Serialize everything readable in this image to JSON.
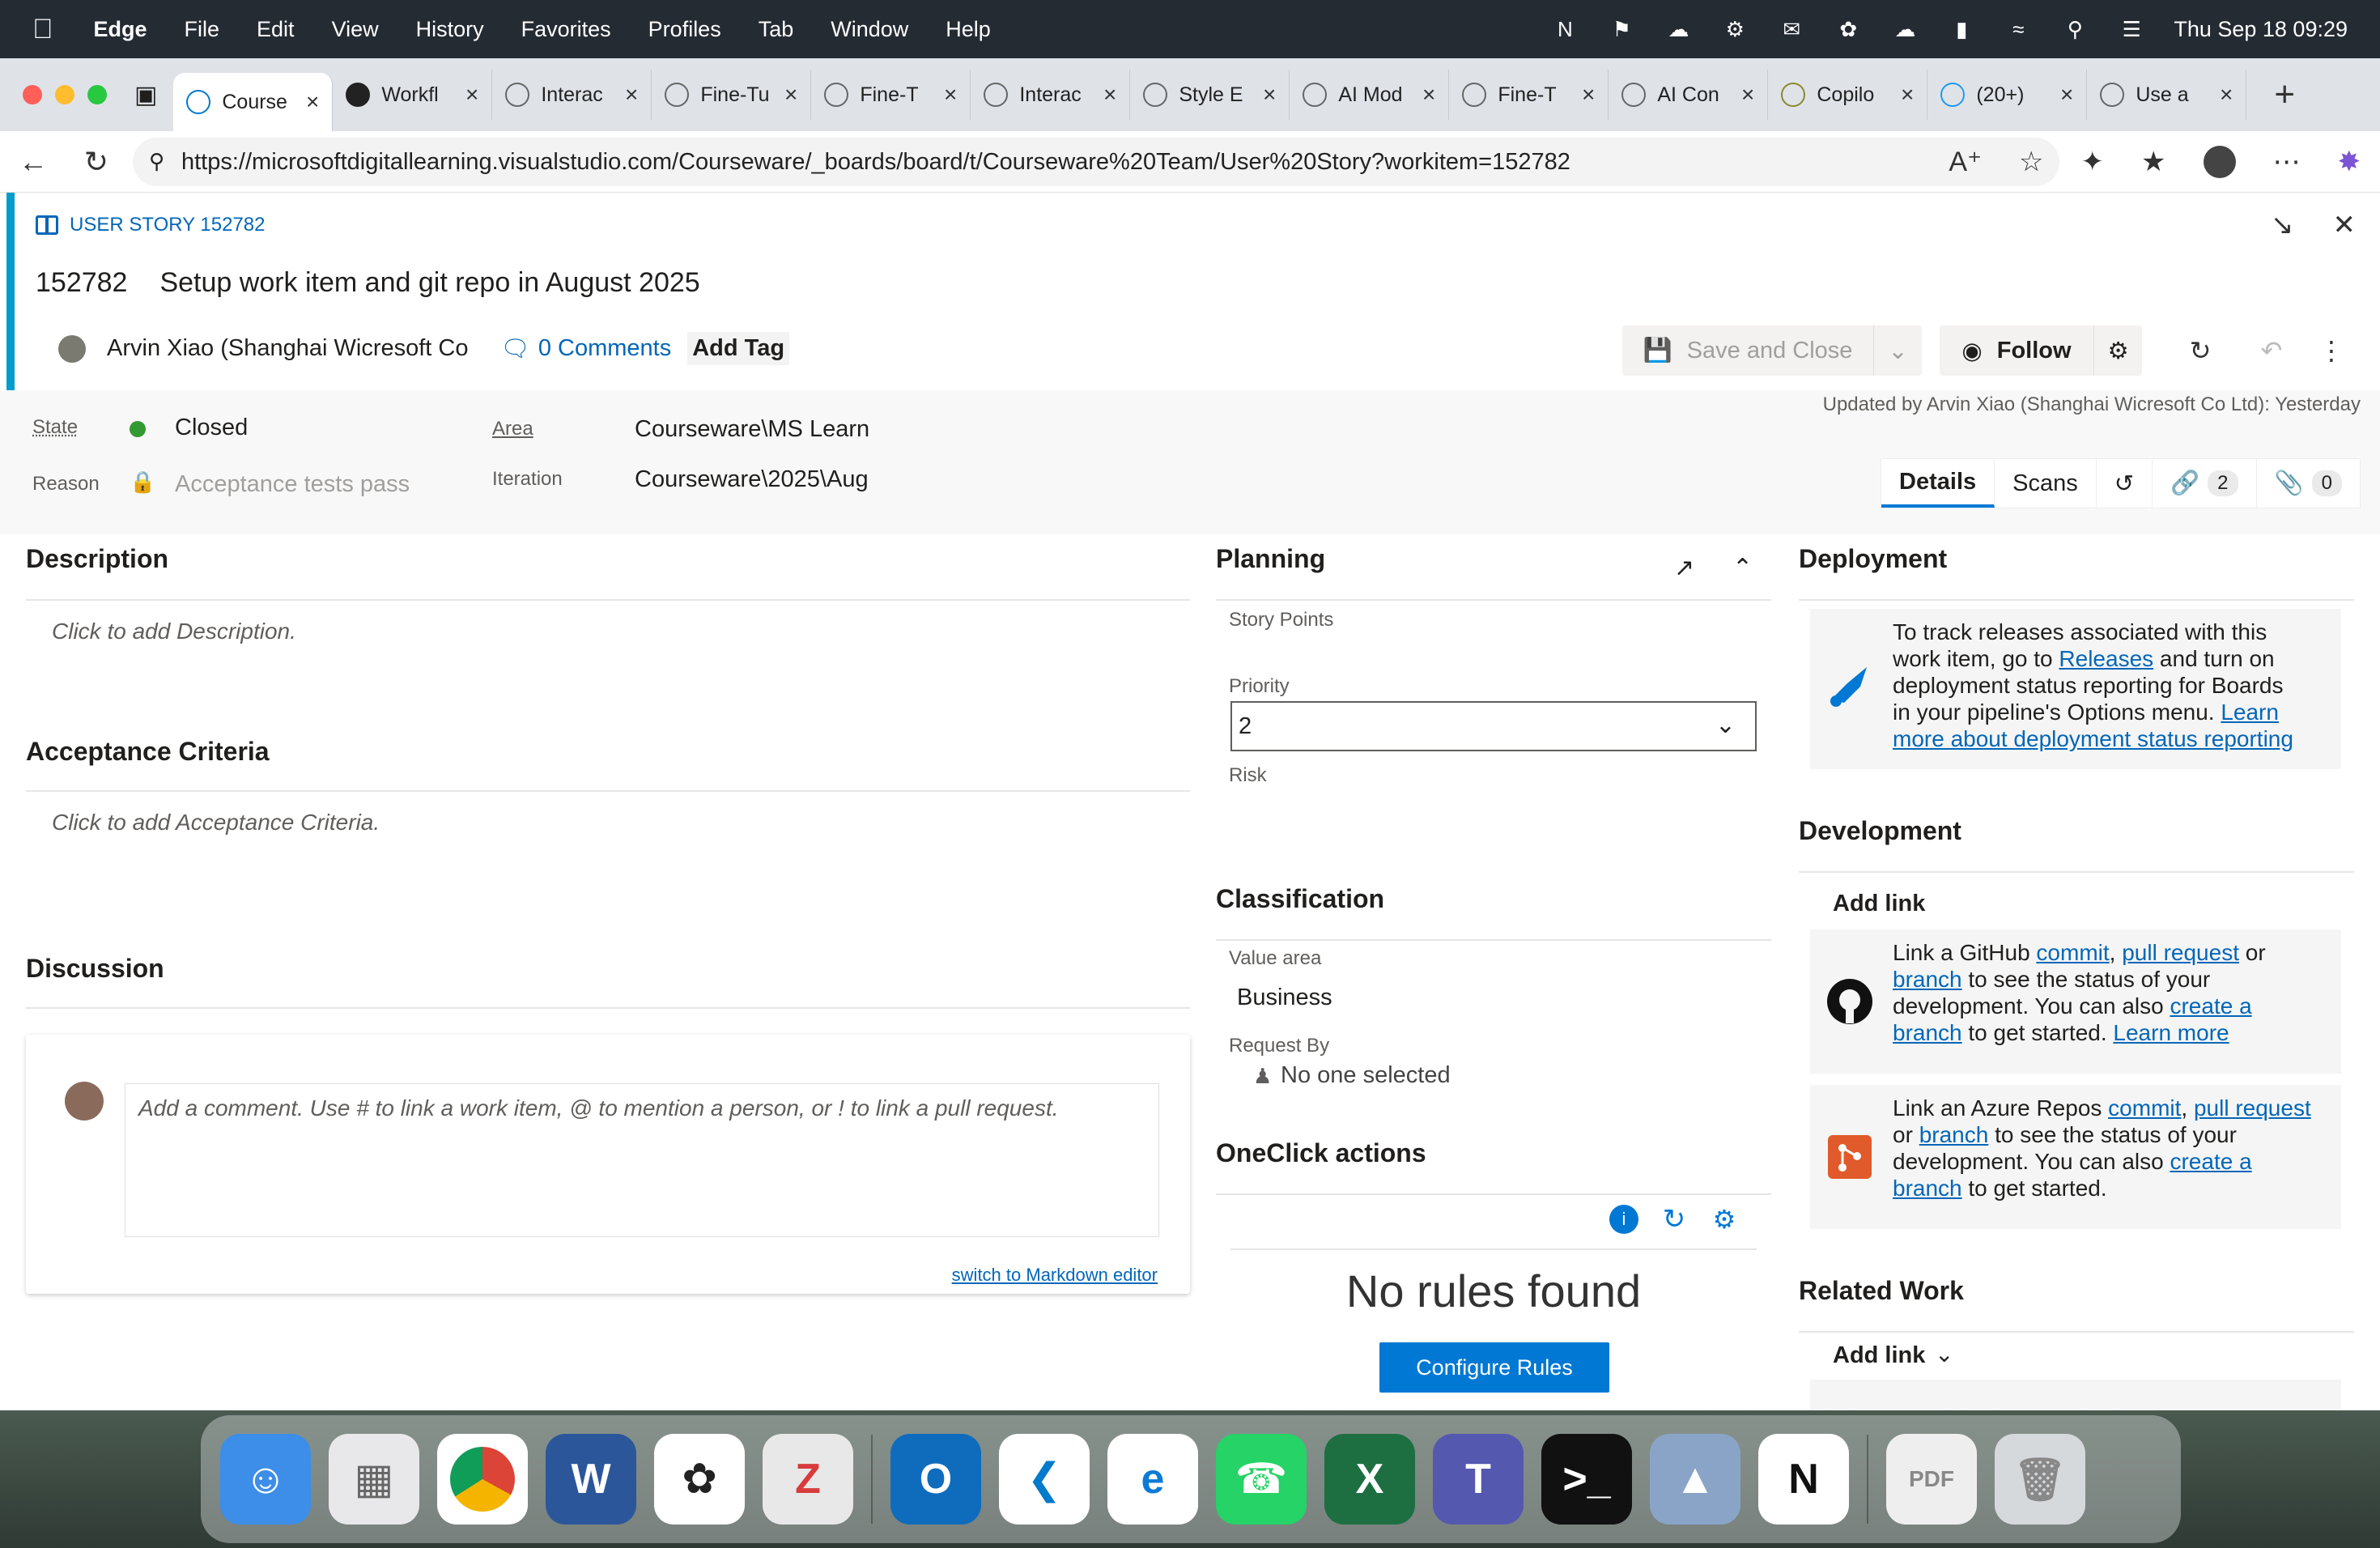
{
  "menubar": {
    "app": "Edge",
    "items": [
      "File",
      "Edit",
      "View",
      "History",
      "Favorites",
      "Profiles",
      "Tab",
      "Window",
      "Help"
    ],
    "datetime": "Thu Sep 18  09:29"
  },
  "tabs": [
    {
      "label": "Course",
      "active": true
    },
    {
      "label": "Workfl"
    },
    {
      "label": "Interac"
    },
    {
      "label": "Fine-Tu"
    },
    {
      "label": "Fine-T"
    },
    {
      "label": "Interac"
    },
    {
      "label": "Style E"
    },
    {
      "label": "AI Mod"
    },
    {
      "label": "Fine-T"
    },
    {
      "label": "AI Con"
    },
    {
      "label": "Copilo"
    },
    {
      "label": "(20+)"
    },
    {
      "label": "Use a"
    }
  ],
  "address": {
    "url": "https://microsoftdigitallearning.visualstudio.com/Courseware/_boards/board/t/Courseware%20Team/User%20Story?workitem=152782"
  },
  "workitem": {
    "type_label": "USER STORY 152782",
    "id": "152782",
    "title": "Setup work item and git repo in August 2025",
    "author": "Arvin Xiao (Shanghai Wicresoft Co",
    "comments": "0 Comments",
    "add_tag": "Add Tag"
  },
  "toolbar": {
    "save_close": "Save and Close",
    "follow": "Follow"
  },
  "fields": {
    "state_label": "State",
    "state_value": "Closed",
    "reason_label": "Reason",
    "reason_value": "Acceptance tests pass",
    "area_label": "Area",
    "area_value": "Courseware\\MS Learn",
    "iteration_label": "Iteration",
    "iteration_value": "Courseware\\2025\\Aug",
    "updated_by": "Updated by Arvin Xiao (Shanghai Wicresoft Co Ltd): Yesterday"
  },
  "detail_tabs": {
    "details": "Details",
    "scans": "Scans",
    "links_count": "2",
    "attachments_count": "0"
  },
  "description": {
    "title": "Description",
    "placeholder": "Click to add Description."
  },
  "acceptance": {
    "title": "Acceptance Criteria",
    "placeholder": "Click to add Acceptance Criteria."
  },
  "discussion": {
    "title": "Discussion",
    "placeholder": "Add a comment. Use # to link a work item, @ to mention a person, or ! to link a pull request.",
    "markdown_link": "switch to Markdown editor"
  },
  "planning": {
    "title": "Planning",
    "story_points": "Story Points",
    "priority_label": "Priority",
    "priority_value": "2",
    "risk_label": "Risk"
  },
  "classification": {
    "title": "Classification",
    "value_area_label": "Value area",
    "value_area": "Business",
    "request_by_label": "Request By",
    "request_by": "No one selected"
  },
  "oneclick": {
    "title": "OneClick actions",
    "no_rules": "No rules found",
    "configure": "Configure Rules"
  },
  "deployment": {
    "title": "Deployment",
    "t1": "To track releases associated with this",
    "t2a": "work item, go to ",
    "t2link": "Releases",
    "t2b": " and turn on",
    "t3": "deployment status reporting for Boards",
    "t4a": "in your pipeline's Options menu. ",
    "t4link": "Learn",
    "t5link": "more about deployment status reporting"
  },
  "development": {
    "title": "Development",
    "add_link": "Add link",
    "gh1a": "Link a GitHub ",
    "gh_commit": "commit",
    "gh_sep1": ", ",
    "gh_pr": "pull request",
    "gh1b": " or",
    "gh_branch": "branch",
    "gh2b": " to see the status of your",
    "gh3a": "development. You can also ",
    "gh_create": "create a",
    "gh_branch2": "branch",
    "gh4b": " to get started. ",
    "gh_learn": "Learn more",
    "az1a": "Link an Azure Repos ",
    "az_commit": "commit",
    "az_sep1": ", ",
    "az_pr": "pull request",
    "az2a": "or ",
    "az_branch": "branch",
    "az2b": " to see the status of your",
    "az3a": "development. You can also ",
    "az_create": "create a",
    "az_branch2": "branch",
    "az4b": " to get started."
  },
  "related": {
    "title": "Related Work",
    "add_link": "Add link"
  },
  "colors": {
    "accent": "#0078d4",
    "story_blue": "#009ccc",
    "closed_green": "#339933",
    "link": "#0366b8"
  }
}
